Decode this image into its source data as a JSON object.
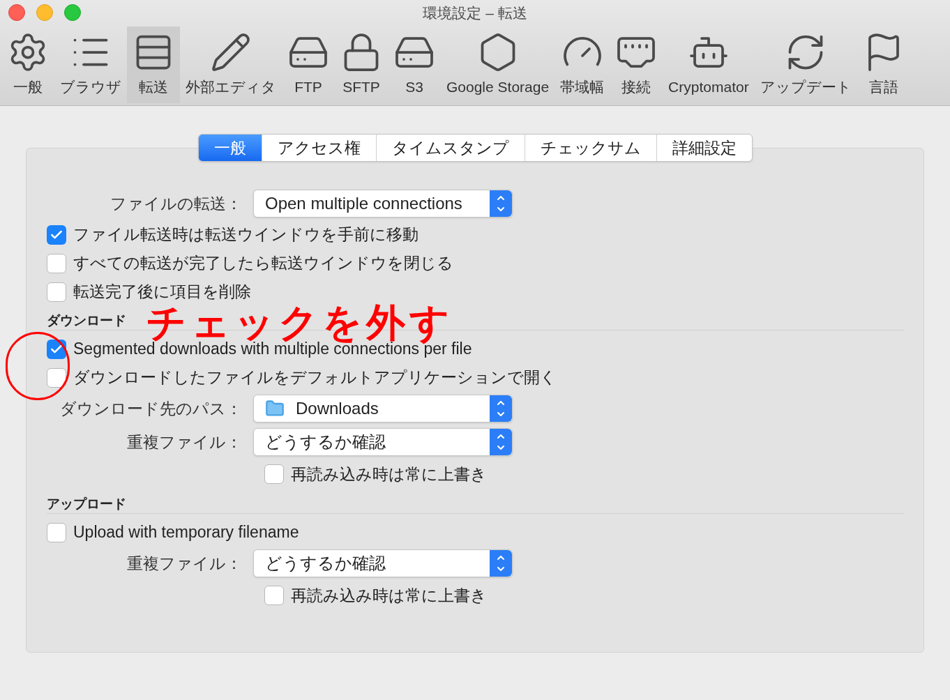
{
  "window": {
    "title": "環境設定 – 転送"
  },
  "toolbar": [
    {
      "label": "一般",
      "selected": false
    },
    {
      "label": "ブラウザ",
      "selected": false
    },
    {
      "label": "転送",
      "selected": true
    },
    {
      "label": "外部エディタ",
      "selected": false
    },
    {
      "label": "FTP",
      "selected": false
    },
    {
      "label": "SFTP",
      "selected": false
    },
    {
      "label": "S3",
      "selected": false
    },
    {
      "label": "Google Storage",
      "selected": false
    },
    {
      "label": "帯域幅",
      "selected": false
    },
    {
      "label": "接続",
      "selected": false
    },
    {
      "label": "Cryptomator",
      "selected": false
    },
    {
      "label": "アップデート",
      "selected": false
    },
    {
      "label": "言語",
      "selected": false
    }
  ],
  "tabs": [
    {
      "label": "一般",
      "selected": true
    },
    {
      "label": "アクセス権",
      "selected": false
    },
    {
      "label": "タイムスタンプ",
      "selected": false
    },
    {
      "label": "チェックサム",
      "selected": false
    },
    {
      "label": "詳細設定",
      "selected": false
    }
  ],
  "rows": [
    {
      "kind": "select",
      "label": "ファイルの転送：",
      "value": "Open multiple connections"
    },
    {
      "kind": "checkbox",
      "label": "ファイル転送時は転送ウインドウを手前に移動",
      "checked": true
    },
    {
      "kind": "checkbox",
      "label": "すべての転送が完了したら転送ウインドウを閉じる",
      "checked": false
    },
    {
      "kind": "checkbox",
      "label": "転送完了後に項目を削除",
      "checked": false
    },
    {
      "kind": "section",
      "label": "ダウンロード"
    },
    {
      "kind": "checkbox",
      "label": "Segmented downloads with multiple connections per file",
      "checked": true
    },
    {
      "kind": "checkbox",
      "label": "ダウンロードしたファイルをデフォルトアプリケーションで開く",
      "checked": false
    },
    {
      "kind": "folder",
      "label": "ダウンロード先のパス：",
      "value": "Downloads"
    },
    {
      "kind": "select",
      "label": "重複ファイル：",
      "value": "どうするか確認"
    },
    {
      "kind": "subcheckbox",
      "label": "再読み込み時は常に上書き",
      "checked": false
    },
    {
      "kind": "section",
      "label": "アップロード"
    },
    {
      "kind": "checkbox",
      "label": "Upload with temporary filename",
      "checked": false
    },
    {
      "kind": "select",
      "label": "重複ファイル：",
      "value": "どうするか確認"
    },
    {
      "kind": "subcheckbox",
      "label": "再読み込み時は常に上書き",
      "checked": false
    }
  ],
  "annotation": {
    "text": "チェックを外す"
  }
}
